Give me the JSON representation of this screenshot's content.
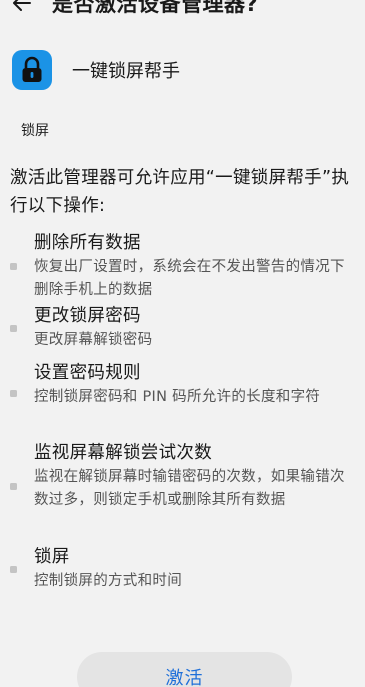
{
  "header": {
    "title": "是否激活设备管理器?"
  },
  "app": {
    "name": "一键锁屏帮手",
    "icon": "lock-icon",
    "icon_color": "#1b93e6"
  },
  "section_label": "锁屏",
  "description": "激活此管理器可允许应用“一键锁屏帮手”执行以下操作:",
  "permissions": [
    {
      "title": "删除所有数据",
      "detail": "恢复出厂设置时，系统会在不发出警告的情况下删除手机上的数据"
    },
    {
      "title": "更改锁屏密码",
      "detail": "更改屏幕解锁密码"
    },
    {
      "title": "设置密码规则",
      "detail": "控制锁屏密码和 PIN 码所允许的长度和字符"
    },
    {
      "title": "监视屏幕解锁尝试次数",
      "detail": "监视在解锁屏幕时输错密码的次数，如果输错次数过多，则锁定手机或删除其所有数据"
    },
    {
      "title": "锁屏",
      "detail": "控制锁屏的方式和时间"
    }
  ],
  "activate_button": {
    "label": "激活",
    "color": "#1e6fd9"
  }
}
